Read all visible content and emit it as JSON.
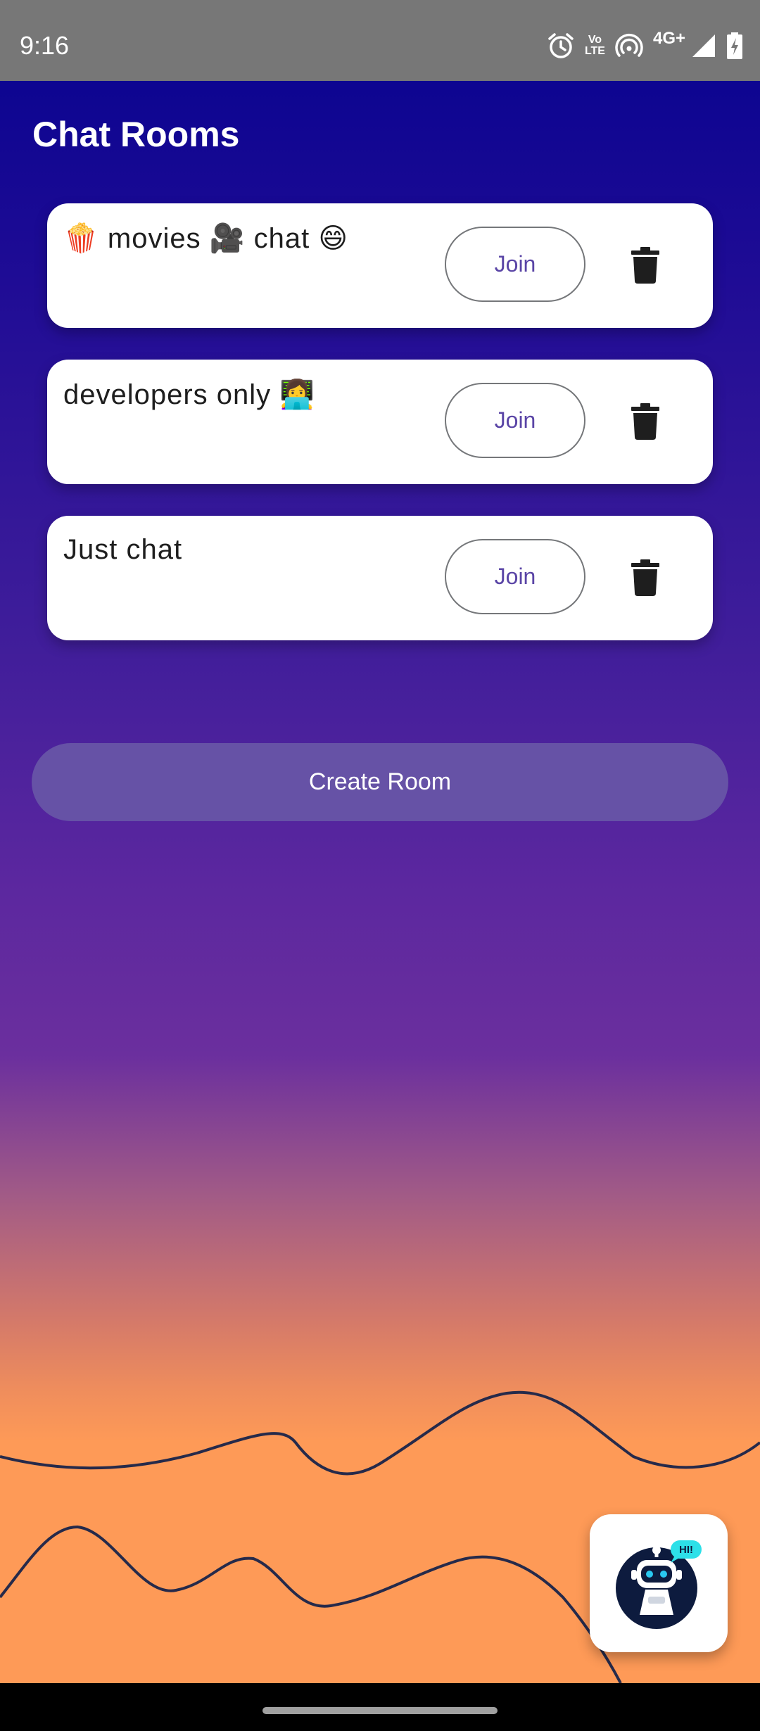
{
  "status_bar": {
    "time": "9:16",
    "network": "4G+",
    "volte_top": "Vo",
    "volte_bottom": "LTE",
    "icons": [
      "alarm-icon",
      "volte-icon",
      "hotspot-icon",
      "signal-icon",
      "battery-charging-icon"
    ]
  },
  "page": {
    "title": "Chat Rooms"
  },
  "rooms": [
    {
      "name": "🍿 movies 🎥 chat 😄",
      "join_label": "Join",
      "delete_icon": "trash-icon"
    },
    {
      "name": "developers only 👩‍💻",
      "join_label": "Join",
      "delete_icon": "trash-icon"
    },
    {
      "name": "Just chat",
      "join_label": "Join",
      "delete_icon": "trash-icon"
    }
  ],
  "create_room": {
    "label": "Create Room"
  },
  "chatbot": {
    "badge": "HI!",
    "icon": "robot-icon"
  },
  "colors": {
    "gradient_top": "#06028f",
    "gradient_mid": "#5b279f",
    "gradient_bottom": "#fe9a57",
    "accent": "#5a45a6",
    "create_button": "#6652a6",
    "status_bar": "#777777"
  }
}
